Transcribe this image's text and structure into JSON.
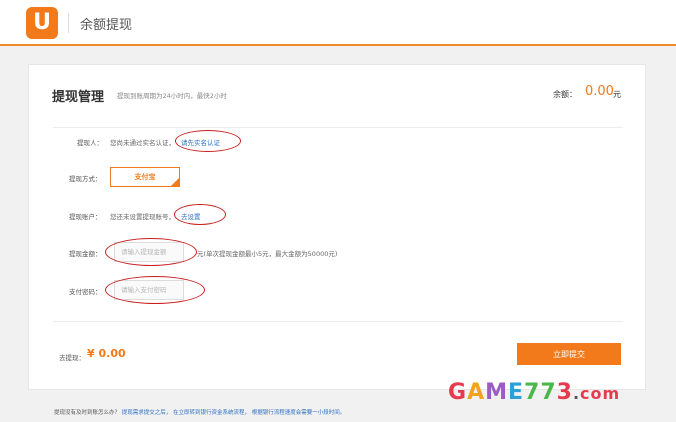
{
  "header": {
    "logo_letter": "U",
    "title": "余额提现",
    "accent_color": "#f27a1a"
  },
  "card": {
    "title": "提现管理",
    "subtitle": "提现到账周期为24小时内，最快2小时",
    "balance_label": "余额：",
    "balance_value": "0.00",
    "balance_unit": "元"
  },
  "form": {
    "withdrawer": {
      "label": "提现人：",
      "note": "您尚未通过实名认证，",
      "link": "请先实名认证"
    },
    "method": {
      "label": "提现方式：",
      "option": "支付宝"
    },
    "account": {
      "label": "提现账户：",
      "note": "您还未设置提现账号，",
      "link": "去设置"
    },
    "amount": {
      "label": "提现金额：",
      "placeholder": "请输入提现金额",
      "hint": "元(单次提现金额最小5元，最大金额为50000元)"
    },
    "password": {
      "label": "支付密码：",
      "placeholder": "请输入支付密码"
    }
  },
  "footer_bar": {
    "fee_label": "去提现：",
    "fee_value": "¥ 0.00",
    "submit_label": "立即提交"
  },
  "footer_note": {
    "question": "提现没有及时到账怎么办？",
    "link1": "提现需求提交之后，",
    "link2": "在立即转到银行资金系统流程，",
    "link3": "根据银行流程速度会需要一小段时间。"
  },
  "watermark": {
    "g": "G",
    "a": "A",
    "m": "M",
    "e": "E",
    "d7a": "7",
    "d7b": "7",
    "d3": "3",
    "dot": ".",
    "com": "com"
  }
}
